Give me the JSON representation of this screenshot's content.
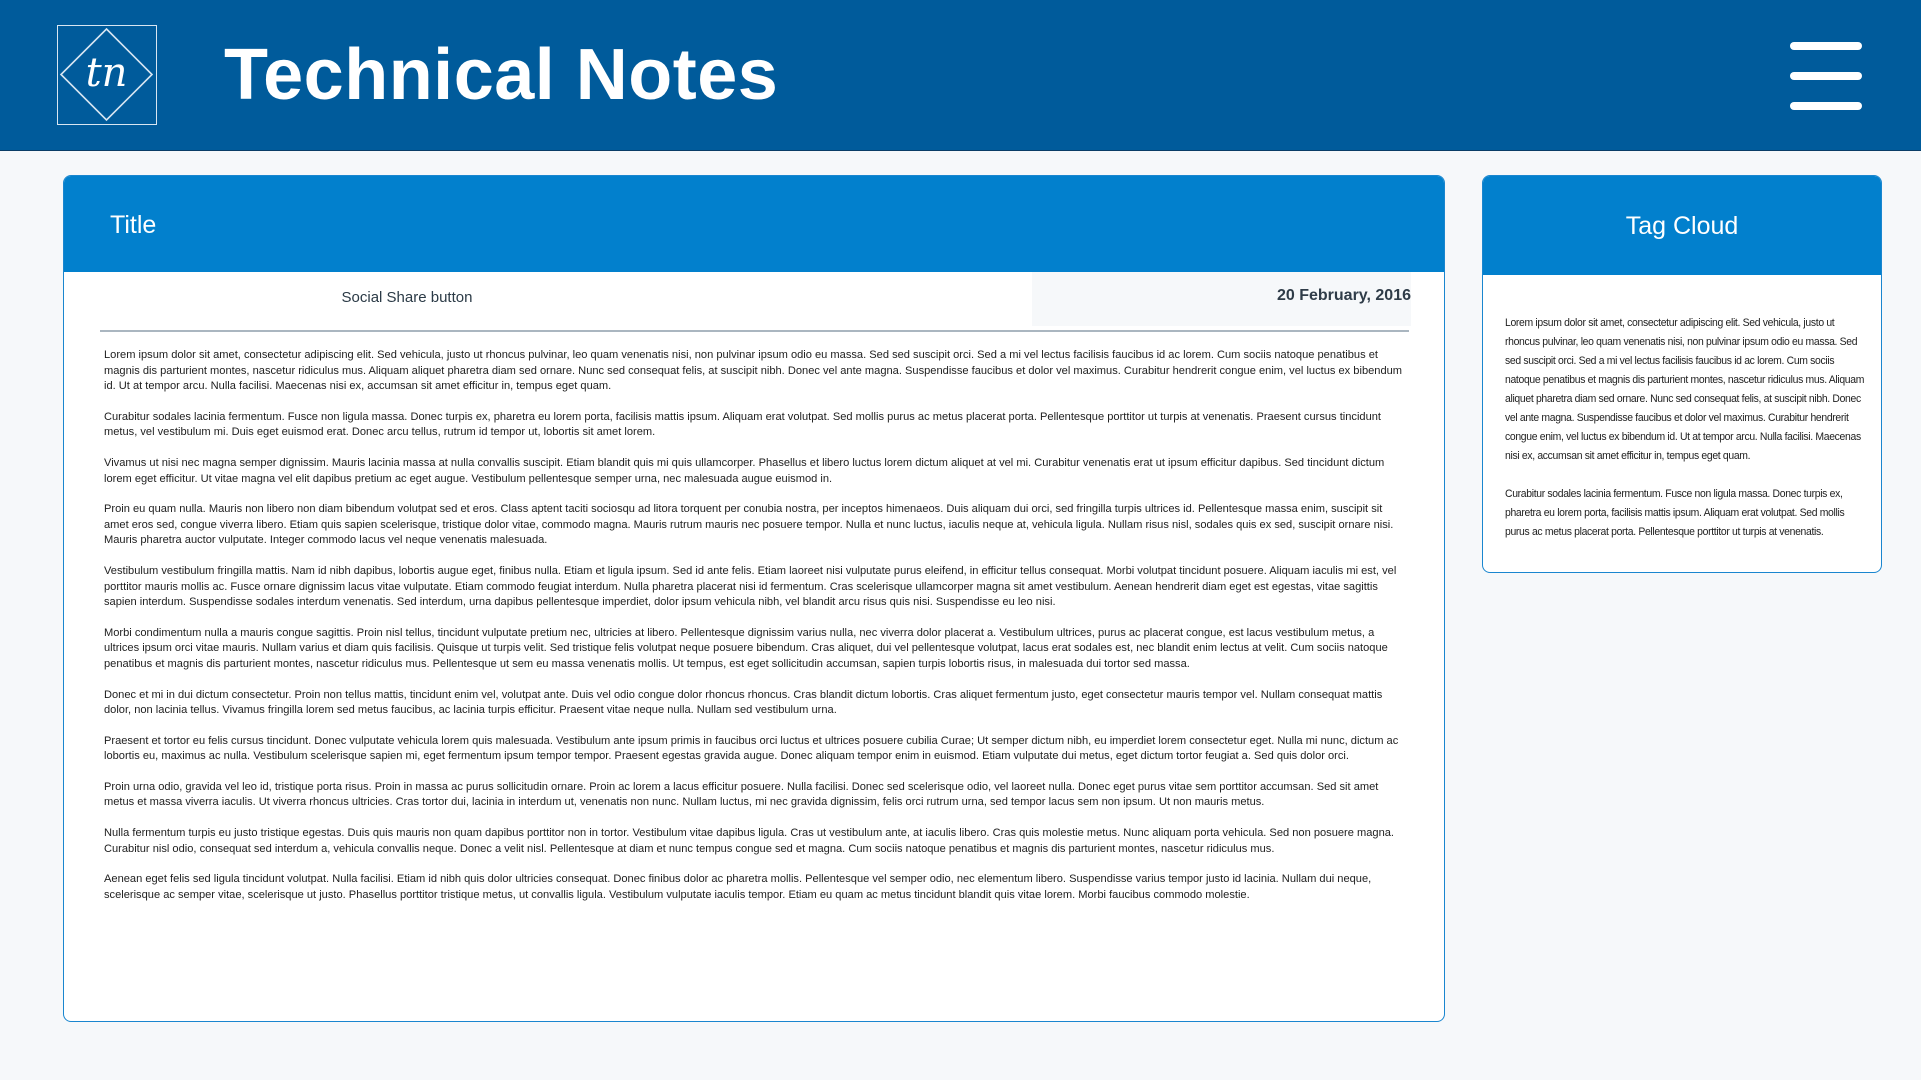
{
  "header": {
    "logo_text": "tn",
    "site_title": "Technical Notes",
    "menu_icon": "hamburger-menu-icon"
  },
  "colors": {
    "header_bg": "#005b9b",
    "card_head_bg": "#0280cd",
    "card_border": "#1a86cf",
    "page_bg": "#f6f8fa"
  },
  "article": {
    "title": "Title",
    "share_label": "Social Share button",
    "date": "20 February, 2016",
    "paragraphs": [
      "Lorem ipsum dolor sit amet, consectetur adipiscing elit. Sed vehicula, justo ut rhoncus pulvinar, leo quam venenatis nisi, non pulvinar ipsum odio eu massa. Sed sed suscipit orci. Sed a mi vel lectus facilisis faucibus id ac lorem. Cum sociis natoque penatibus et magnis dis parturient montes, nascetur ridiculus mus. Aliquam aliquet pharetra diam sed ornare. Nunc sed consequat felis, at suscipit nibh. Donec vel ante magna. Suspendisse faucibus et dolor vel maximus. Curabitur hendrerit congue enim, vel luctus ex bibendum id. Ut at tempor arcu. Nulla facilisi. Maecenas nisi ex, accumsan sit amet efficitur in, tempus eget quam.",
      "Curabitur sodales lacinia fermentum. Fusce non ligula massa. Donec turpis ex, pharetra eu lorem porta, facilisis mattis ipsum. Aliquam erat volutpat. Sed mollis purus ac metus placerat porta. Pellentesque porttitor ut turpis at venenatis. Praesent cursus tincidunt metus, vel vestibulum mi. Duis eget euismod erat. Donec arcu tellus, rutrum id tempor ut, lobortis sit amet lorem.",
      "Vivamus ut nisi nec magna semper dignissim. Mauris lacinia massa at nulla convallis suscipit. Etiam blandit quis mi quis ullamcorper. Phasellus et libero luctus lorem dictum aliquet at vel mi. Curabitur venenatis erat ut ipsum efficitur dapibus. Sed tincidunt dictum lorem eget efficitur. Ut vitae magna vel elit dapibus pretium ac eget augue. Vestibulum pellentesque semper urna, nec malesuada augue euismod in.",
      "Proin eu quam nulla. Mauris non libero non diam bibendum volutpat sed et eros. Class aptent taciti sociosqu ad litora torquent per conubia nostra, per inceptos himenaeos. Duis aliquam dui orci, sed fringilla turpis ultrices id. Pellentesque massa enim, suscipit sit amet eros sed, congue viverra libero. Etiam quis sapien scelerisque, tristique dolor vitae, commodo magna. Mauris rutrum mauris nec posuere tempor. Nulla et nunc luctus, iaculis neque at, vehicula ligula. Nullam risus nisl, sodales quis ex sed, suscipit ornare nisi. Mauris pharetra auctor vulputate. Integer commodo lacus vel neque venenatis malesuada.",
      "Vestibulum vestibulum fringilla mattis. Nam id nibh dapibus, lobortis augue eget, finibus nulla. Etiam et ligula ipsum. Sed id ante felis. Etiam laoreet nisi vulputate purus eleifend, in efficitur tellus consequat. Morbi volutpat tincidunt posuere. Aliquam iaculis mi est, vel porttitor mauris mollis ac. Fusce ornare dignissim lacus vitae vulputate. Etiam commodo feugiat interdum. Nulla pharetra placerat nisi id fermentum. Cras scelerisque ullamcorper magna sit amet vestibulum. Aenean hendrerit diam eget est egestas, vitae sagittis sapien interdum. Suspendisse sodales interdum venenatis. Sed interdum, urna dapibus pellentesque imperdiet, dolor ipsum vehicula nibh, vel blandit arcu risus quis nisi. Suspendisse eu leo nisi.",
      "Morbi condimentum nulla a mauris congue sagittis. Proin nisl tellus, tincidunt vulputate pretium nec, ultricies at libero. Pellentesque dignissim varius nulla, nec viverra dolor placerat a. Vestibulum ultrices, purus ac placerat congue, est lacus vestibulum metus, a ultrices ipsum orci vitae mauris. Nullam varius et diam quis facilisis. Quisque ut turpis velit. Sed tristique felis volutpat neque posuere bibendum. Cras aliquet, dui vel pellentesque volutpat, lacus erat sodales est, nec blandit enim lectus at velit. Cum sociis natoque penatibus et magnis dis parturient montes, nascetur ridiculus mus. Pellentesque ut sem eu massa venenatis mollis. Ut tempus, est eget sollicitudin accumsan, sapien turpis lobortis risus, in malesuada dui tortor sed massa.",
      "Donec et mi in dui dictum consectetur. Proin non tellus mattis, tincidunt enim vel, volutpat ante. Duis vel odio congue dolor rhoncus rhoncus. Cras blandit dictum lobortis. Cras aliquet fermentum justo, eget consectetur mauris tempor vel. Nullam consequat mattis dolor, non lacinia tellus. Vivamus fringilla lorem sed metus faucibus, ac lacinia turpis efficitur. Praesent vitae neque nulla. Nullam sed vestibulum urna.",
      "Praesent et tortor eu felis cursus tincidunt. Donec vulputate vehicula lorem quis malesuada. Vestibulum ante ipsum primis in faucibus orci luctus et ultrices posuere cubilia Curae; Ut semper dictum nibh, eu imperdiet lorem consectetur eget. Nulla mi nunc, dictum ac lobortis eu, maximus ac nulla. Vestibulum scelerisque sapien mi, eget fermentum ipsum tempor tempor. Praesent egestas gravida augue. Donec aliquam tempor enim in euismod. Etiam vulputate dui metus, eget dictum tortor feugiat a. Sed quis dolor orci.",
      "Proin urna odio, gravida vel leo id, tristique porta risus. Proin in massa ac purus sollicitudin ornare. Proin ac lorem a lacus efficitur posuere. Nulla facilisi. Donec sed scelerisque odio, vel laoreet nulla. Donec eget purus vitae sem porttitor accumsan. Sed sit amet metus et massa viverra iaculis. Ut viverra rhoncus ultricies. Cras tortor dui, lacinia in interdum ut, venenatis non nunc. Nullam luctus, mi nec gravida dignissim, felis orci rutrum urna, sed tempor lacus sem non ipsum. Ut non mauris metus.",
      "Nulla fermentum turpis eu justo tristique egestas. Duis quis mauris non quam dapibus porttitor non in tortor. Vestibulum vitae dapibus ligula. Cras ut vestibulum ante, at iaculis libero. Cras quis molestie metus. Nunc aliquam porta vehicula. Sed non posuere magna. Curabitur nisl odio, consequat sed interdum a, vehicula convallis neque. Donec a velit nisl. Pellentesque at diam et nunc tempus congue sed et magna. Cum sociis natoque penatibus et magnis dis parturient montes, nascetur ridiculus mus.",
      "Aenean eget felis sed ligula tincidunt volutpat. Nulla facilisi. Etiam id nibh quis dolor ultricies consequat. Donec finibus dolor ac pharetra mollis. Pellentesque vel semper odio, nec elementum libero. Suspendisse varius tempor justo id lacinia. Nullam dui neque, scelerisque ac semper vitae, scelerisque ut justo. Phasellus porttitor tristique metus, ut convallis ligula. Vestibulum vulputate iaculis tempor. Etiam eu quam ac metus tincidunt blandit quis vitae lorem. Morbi faucibus commodo molestie."
    ]
  },
  "sidebar": {
    "title": "Tag Cloud",
    "paragraphs": [
      "Lorem ipsum dolor sit amet, consectetur adipiscing elit. Sed vehicula, justo ut rhoncus pulvinar, leo quam venenatis nisi, non pulvinar ipsum odio eu massa. Sed sed suscipit orci. Sed a mi vel lectus facilisis faucibus id ac lorem. Cum sociis natoque penatibus et magnis dis parturient montes, nascetur ridiculus mus. Aliquam aliquet pharetra diam sed ornare. Nunc sed consequat felis, at suscipit nibh. Donec vel ante magna. Suspendisse faucibus et dolor vel maximus. Curabitur hendrerit congue enim, vel luctus ex bibendum id. Ut at tempor arcu. Nulla facilisi. Maecenas nisi ex, accumsan sit amet efficitur in, tempus eget quam.",
      "Curabitur sodales lacinia fermentum. Fusce non ligula massa. Donec turpis ex, pharetra eu lorem porta, facilisis mattis ipsum. Aliquam erat volutpat. Sed mollis purus ac metus placerat porta. Pellentesque porttitor ut turpis at venenatis."
    ]
  }
}
